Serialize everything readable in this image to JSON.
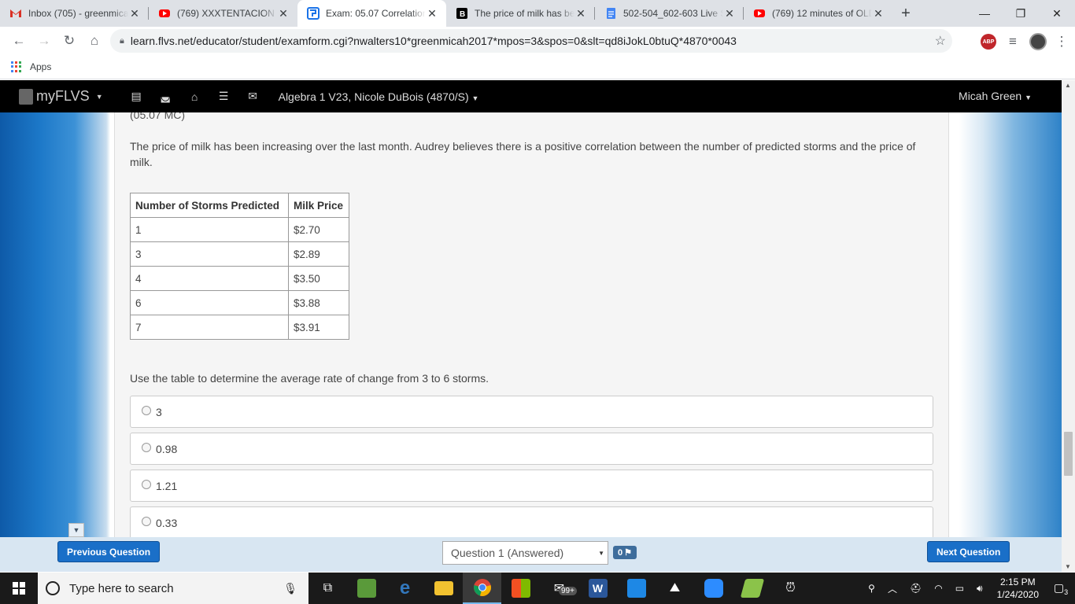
{
  "browser": {
    "tabs": [
      {
        "title": "Inbox (705) - greenmicah",
        "icon": "gmail-icon",
        "color": "#d93025"
      },
      {
        "title": "(769) XXXTENTACION -",
        "icon": "youtube-icon",
        "color": "#ff0000"
      },
      {
        "title": "Exam: 05.07 Correlation",
        "icon": "flvs-icon",
        "color": "#1a73e8"
      },
      {
        "title": "The price of milk has be",
        "icon": "brainly-icon",
        "color": "#000000"
      },
      {
        "title": "502-504_602-603 Live S",
        "icon": "docs-icon",
        "color": "#4285f4"
      },
      {
        "title": "(769) 12 minutes of OLD",
        "icon": "youtube-icon",
        "color": "#ff0000"
      }
    ],
    "url": "learn.flvs.net/educator/student/examform.cgi?nwalters10*greenmicah2017*mpos=3&spos=0&slt=qd8iJokL0btuQ*4870*0043",
    "abp_label": "ABP",
    "bookmarks_apps": "Apps"
  },
  "navbar": {
    "brand": "myFLVS",
    "course": "Algebra 1 V23, Nicole DuBois (4870/S)",
    "user": "Micah Green"
  },
  "question": {
    "tag": "(05.07 MC)",
    "text": "The price of milk has been increasing over the last month. Audrey believes there is a positive correlation between the number of predicted storms and the price of milk.",
    "table": {
      "headers": [
        "Number of Storms Predicted",
        "Milk Price"
      ],
      "rows": [
        [
          "1",
          "$2.70"
        ],
        [
          "3",
          "$2.89"
        ],
        [
          "4",
          "$3.50"
        ],
        [
          "6",
          "$3.88"
        ],
        [
          "7",
          "$3.91"
        ]
      ]
    },
    "prompt": "Use the table to determine the average rate of change from 3 to 6 storms.",
    "options": [
      "3",
      "0.98",
      "1.21",
      "0.33"
    ]
  },
  "footer": {
    "prev": "Previous Question",
    "next": "Next Question",
    "select": "Question 1 (Answered)",
    "flag_count": "0"
  },
  "taskbar": {
    "search_placeholder": "Type here to search",
    "time": "2:15 PM",
    "date": "1/24/2020",
    "mail_badge": "99+",
    "notif_count": "3"
  }
}
